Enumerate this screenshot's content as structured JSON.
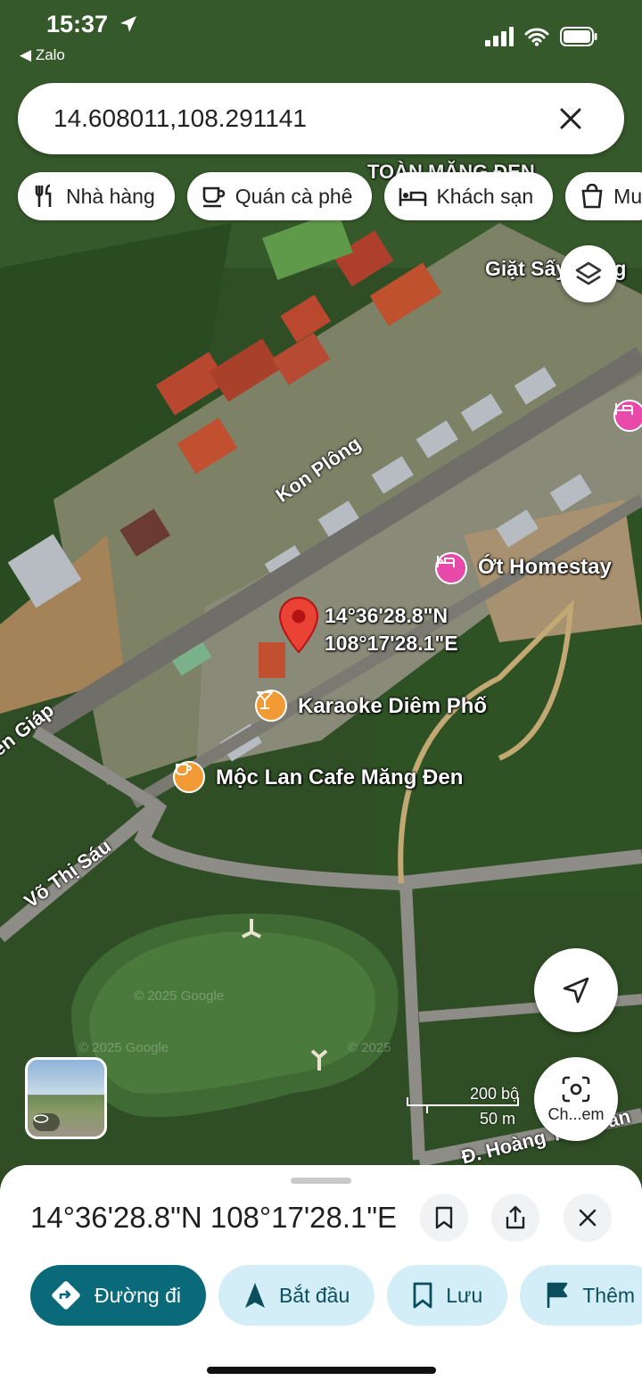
{
  "status_bar": {
    "time": "15:37",
    "back_app": "Zalo"
  },
  "search": {
    "value": "14.608011,108.291141"
  },
  "chips": [
    {
      "icon": "restaurant-icon",
      "label": "Nhà hàng"
    },
    {
      "icon": "coffee-icon",
      "label": "Quán cà phê"
    },
    {
      "icon": "hotel-icon",
      "label": "Khách sạn"
    },
    {
      "icon": "shopping-bag-icon",
      "label": "Mu"
    }
  ],
  "map": {
    "pin_coords_line1": "14°36'28.8\"N",
    "pin_coords_line2": "108°17'28.1\"E",
    "poi_homestay": "Ớt Homestay",
    "poi_karaoke": "Karaoke Diêm Phố",
    "poi_cafe": "Mộc Lan Cafe Măng Đen",
    "label_toan_mang_den": "TOÀN MĂNG ĐEN",
    "label_giat_say": "Giặt Sấy Măng",
    "street_kon_plong": "Kon Plông",
    "street_vo_thi_sau": "Võ Thị Sáu",
    "street_giap": "en Giáp",
    "street_hoang": "Đ. Hoàng Thị Loan",
    "watermark1": "© 2025 Google",
    "watermark2": "© 2025 Google",
    "watermark3": "© 2025",
    "scale_feet": "200 bộ",
    "scale_meters": "50 m",
    "camera_label": "Ch...em"
  },
  "sheet": {
    "title": "14°36'28.8\"N 108°17'28.1\"E",
    "actions": [
      {
        "icon": "directions-icon",
        "label": "Đường đi"
      },
      {
        "icon": "navigation-arrow-icon",
        "label": "Bắt đầu"
      },
      {
        "icon": "bookmark-icon",
        "label": "Lưu"
      },
      {
        "icon": "flag-icon",
        "label": "Thêm"
      }
    ]
  },
  "colors": {
    "accent": "#0b6a7a",
    "chip_light": "#d3eef7",
    "pin_red": "#ea4335",
    "poi_orange": "#f29a36",
    "poi_pink": "#e84aa9"
  }
}
